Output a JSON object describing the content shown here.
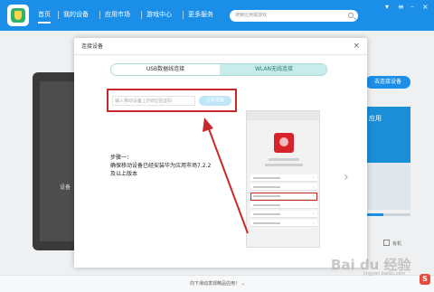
{
  "nav": {
    "items": [
      {
        "label": "首页",
        "active": true
      },
      {
        "label": "我的设备"
      },
      {
        "label": "应用市场"
      },
      {
        "label": "游戏中心"
      },
      {
        "label": "更多服务"
      }
    ],
    "search_placeholder": "搜索应用或游戏",
    "icons": [
      "logo-icon",
      "search-icon",
      "skin-icon",
      "settings-icon",
      "minimize-icon",
      "close-icon"
    ]
  },
  "background": {
    "device_label": "设备",
    "connect_button": "击连接设备",
    "panel_text": "应用",
    "side_label": "有机",
    "bottom_text": "向下滑动发现精品应用！ ⌄"
  },
  "modal": {
    "title": "连接设备",
    "close_symbol": "×",
    "tabs": [
      {
        "label": "USB数据线连接",
        "active": false
      },
      {
        "label": "WLAN无线连接",
        "active": true
      }
    ],
    "code_placeholder": "输入移动设备上的8位验证码",
    "connect_button": "立即连接",
    "step_title": "步骤一：",
    "step_line1": "确保移动设备已经安装华为应用市场7.2.2",
    "step_line2": "及以上版本",
    "next_arrow": "›"
  },
  "watermark": {
    "text": "Bai du 经验",
    "sub": "jingyan.baidu.com",
    "badge": "S"
  },
  "colors": {
    "primary": "#1b8ee8",
    "highlight": "#c9292a",
    "tab_active": "#c7ece9"
  }
}
